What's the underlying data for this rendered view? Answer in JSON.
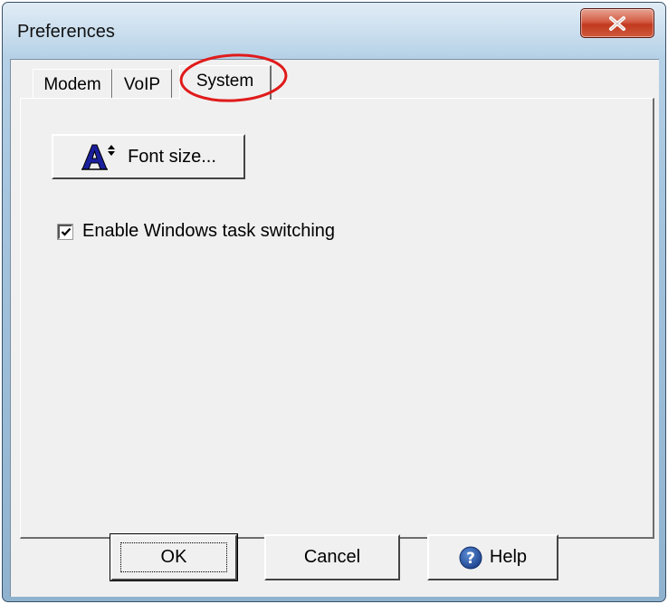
{
  "window": {
    "title": "Preferences",
    "close_glyph": "X"
  },
  "tabs": [
    {
      "label": "Modem"
    },
    {
      "label": "VoIP"
    },
    {
      "label": "System",
      "selected": true
    }
  ],
  "system_tab": {
    "font_size_button_label": "Font size...",
    "font_size_icon": "font-size-icon",
    "task_switching_label": "Enable Windows task switching",
    "task_switching_checked": true
  },
  "buttons": {
    "ok_label": "OK",
    "cancel_label": "Cancel",
    "help_label": "Help",
    "help_icon": "help-icon"
  },
  "annotation": {
    "color": "#e01b1b"
  }
}
